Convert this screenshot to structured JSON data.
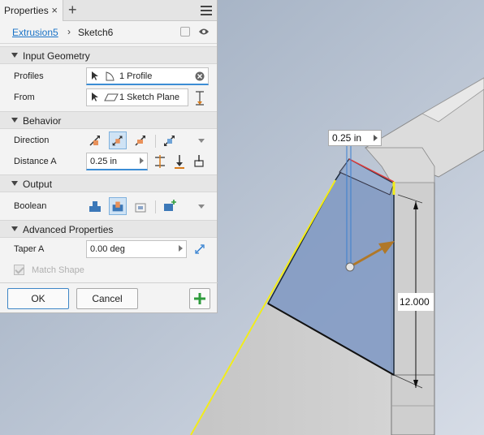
{
  "panel": {
    "tab_label": "Properties",
    "tab_close": "×",
    "tab_add": "+",
    "breadcrumb": {
      "feature": "Extrusion5",
      "separator": "›",
      "sketch": "Sketch6"
    },
    "sections": {
      "input_geometry": "Input Geometry",
      "behavior": "Behavior",
      "output": "Output",
      "advanced": "Advanced Properties"
    },
    "profiles": {
      "label": "Profiles",
      "value": "1 Profile"
    },
    "from": {
      "label": "From",
      "value": "1 Sketch Plane"
    },
    "direction": {
      "label": "Direction"
    },
    "distance_a": {
      "label": "Distance A",
      "value": "0.25 in"
    },
    "boolean": {
      "label": "Boolean"
    },
    "taper_a": {
      "label": "Taper A",
      "value": "0.00 deg"
    },
    "match_shape": {
      "label": "Match Shape"
    },
    "buttons": {
      "ok": "OK",
      "cancel": "Cancel"
    }
  },
  "viewport": {
    "distance_label": "0.25 in",
    "height_label": "12.000"
  },
  "colors": {
    "accent": "#1a73c7",
    "profile_fill": "#7f98c2",
    "model_gray": "#c9c9c9",
    "edge_yellow": "#f2ec1a",
    "arrow": "#b07828"
  }
}
